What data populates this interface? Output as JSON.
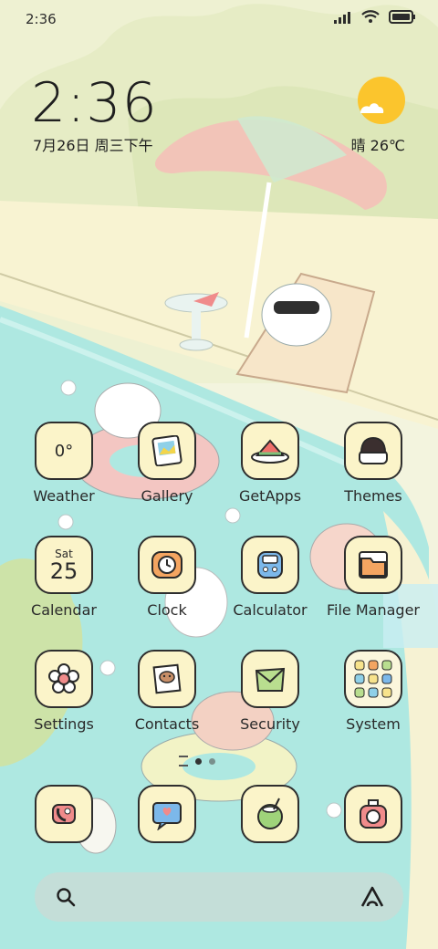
{
  "status_bar": {
    "time": "2:36"
  },
  "clock_widget": {
    "time": "2:36",
    "date": "7月26日 周三下午"
  },
  "weather_widget": {
    "condition_temp": "晴 26℃"
  },
  "apps": [
    {
      "label": "Weather",
      "icon": "weather-icon",
      "value": "0°"
    },
    {
      "label": "Gallery",
      "icon": "gallery-icon"
    },
    {
      "label": "GetApps",
      "icon": "getapps-icon"
    },
    {
      "label": "Themes",
      "icon": "themes-icon"
    },
    {
      "label": "Calendar",
      "icon": "calendar-icon",
      "weekday": "Sat",
      "day": "25"
    },
    {
      "label": "Clock",
      "icon": "clock-icon"
    },
    {
      "label": "Calculator",
      "icon": "calculator-icon"
    },
    {
      "label": "File Manager",
      "icon": "file-manager-icon"
    },
    {
      "label": "Settings",
      "icon": "settings-icon"
    },
    {
      "label": "Contacts",
      "icon": "contacts-icon"
    },
    {
      "label": "Security",
      "icon": "security-icon"
    },
    {
      "label": "System",
      "icon": "system-folder-icon"
    }
  ],
  "dock": [
    {
      "icon": "phone-icon"
    },
    {
      "icon": "messages-icon"
    },
    {
      "icon": "browser-icon"
    },
    {
      "icon": "camera-icon"
    }
  ],
  "page_indicator": {
    "pages": 3,
    "active": 1
  },
  "colors": {
    "tile_bg": "#fbf4c9",
    "pool": "#a9e6df",
    "sun": "#fbc52d"
  }
}
